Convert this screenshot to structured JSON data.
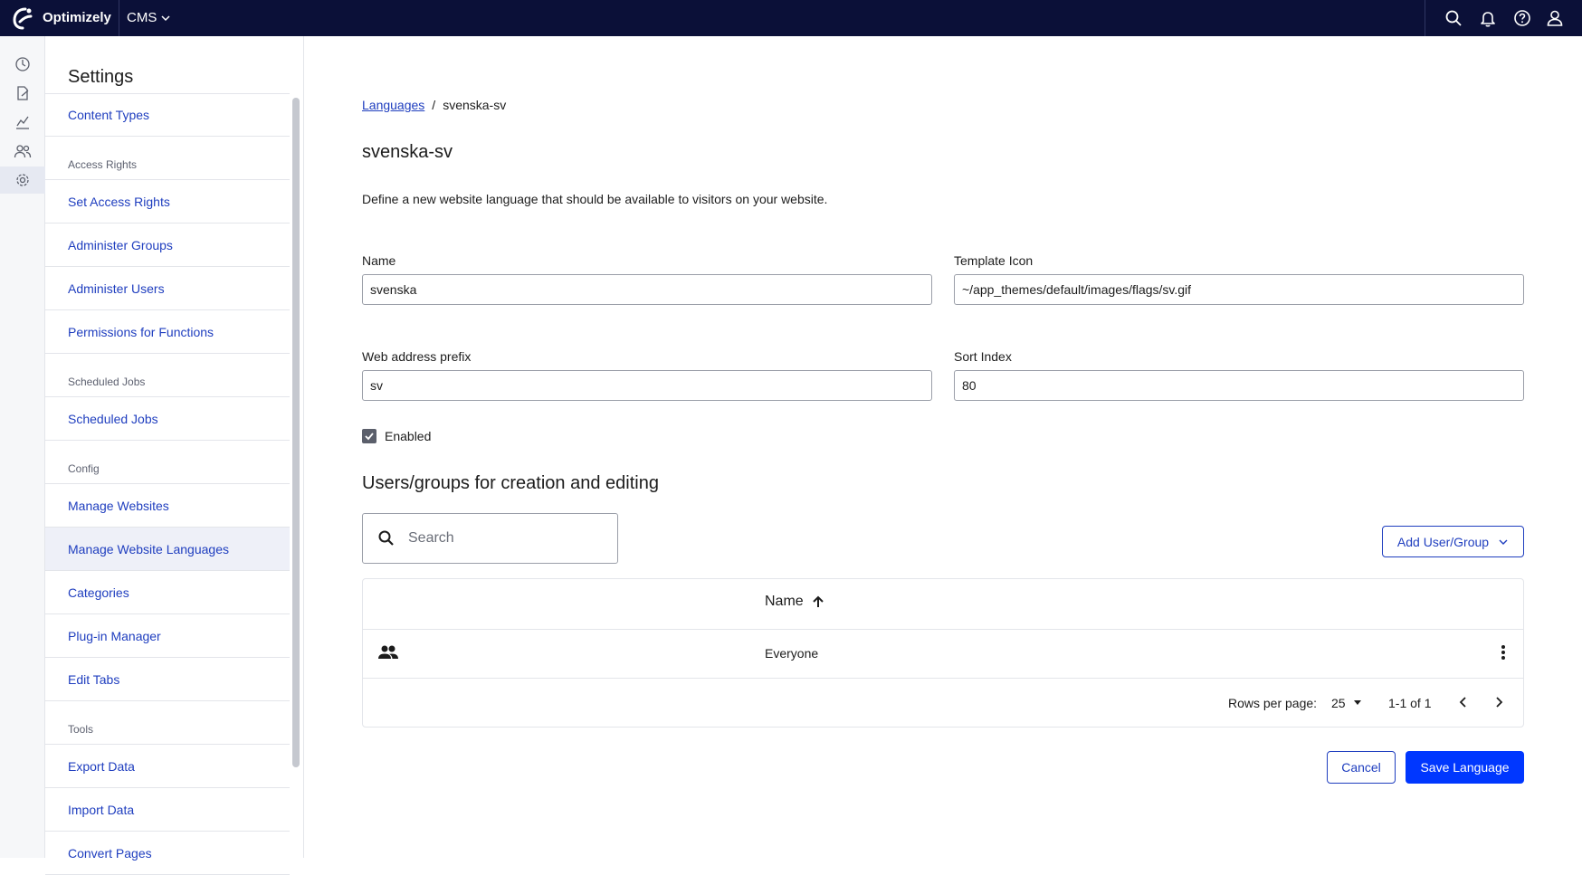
{
  "topbar": {
    "brand": "Optimizely",
    "product": "CMS",
    "icons": [
      "search-icon",
      "bell-icon",
      "help-icon",
      "user-icon"
    ]
  },
  "rail": {
    "icons": [
      "dashboard-icon",
      "edit-page-icon",
      "analytics-icon",
      "users-icon",
      "settings-icon"
    ],
    "active": "settings-icon"
  },
  "sidebar": {
    "title": "Settings",
    "items": [
      {
        "type": "link",
        "label": "Content Types"
      },
      {
        "type": "group",
        "label": "Access Rights"
      },
      {
        "type": "link",
        "label": "Set Access Rights"
      },
      {
        "type": "link",
        "label": "Administer Groups"
      },
      {
        "type": "link",
        "label": "Administer Users"
      },
      {
        "type": "link",
        "label": "Permissions for Functions"
      },
      {
        "type": "group",
        "label": "Scheduled Jobs"
      },
      {
        "type": "link",
        "label": "Scheduled Jobs"
      },
      {
        "type": "group",
        "label": "Config"
      },
      {
        "type": "link",
        "label": "Manage Websites"
      },
      {
        "type": "link",
        "label": "Manage Website Languages",
        "active": true
      },
      {
        "type": "link",
        "label": "Categories"
      },
      {
        "type": "link",
        "label": "Plug-in Manager"
      },
      {
        "type": "link",
        "label": "Edit Tabs"
      },
      {
        "type": "group",
        "label": "Tools"
      },
      {
        "type": "link",
        "label": "Export Data"
      },
      {
        "type": "link",
        "label": "Import Data"
      },
      {
        "type": "link",
        "label": "Convert Pages"
      }
    ]
  },
  "main": {
    "breadcrumb": {
      "parent": "Languages",
      "separator": "/",
      "current": "svenska-sv"
    },
    "title": "svenska-sv",
    "description": "Define a new website language that should be available to visitors on your website.",
    "form": {
      "name": {
        "label": "Name",
        "value": "svenska"
      },
      "template_icon": {
        "label": "Template Icon",
        "value": "~/app_themes/default/images/flags/sv.gif"
      },
      "prefix": {
        "label": "Web address prefix",
        "value": "sv"
      },
      "sort_index": {
        "label": "Sort Index",
        "value": "80"
      },
      "enabled": {
        "label": "Enabled",
        "checked": true
      }
    },
    "users_section": {
      "title": "Users/groups for creation and editing",
      "search_placeholder": "Search",
      "add_button": "Add User/Group",
      "table": {
        "column": "Name",
        "sort": "ascending",
        "rows": [
          {
            "icon": "group-icon",
            "name": "Everyone"
          }
        ]
      },
      "pager": {
        "rows_per_page_label": "Rows per page:",
        "rows_per_page": "25",
        "range": "1-1 of 1"
      }
    },
    "actions": {
      "cancel": "Cancel",
      "save": "Save Language"
    },
    "colors": {
      "primary": "#0037ff",
      "link": "#1f3ebf",
      "topbar": "#0b1038"
    }
  }
}
